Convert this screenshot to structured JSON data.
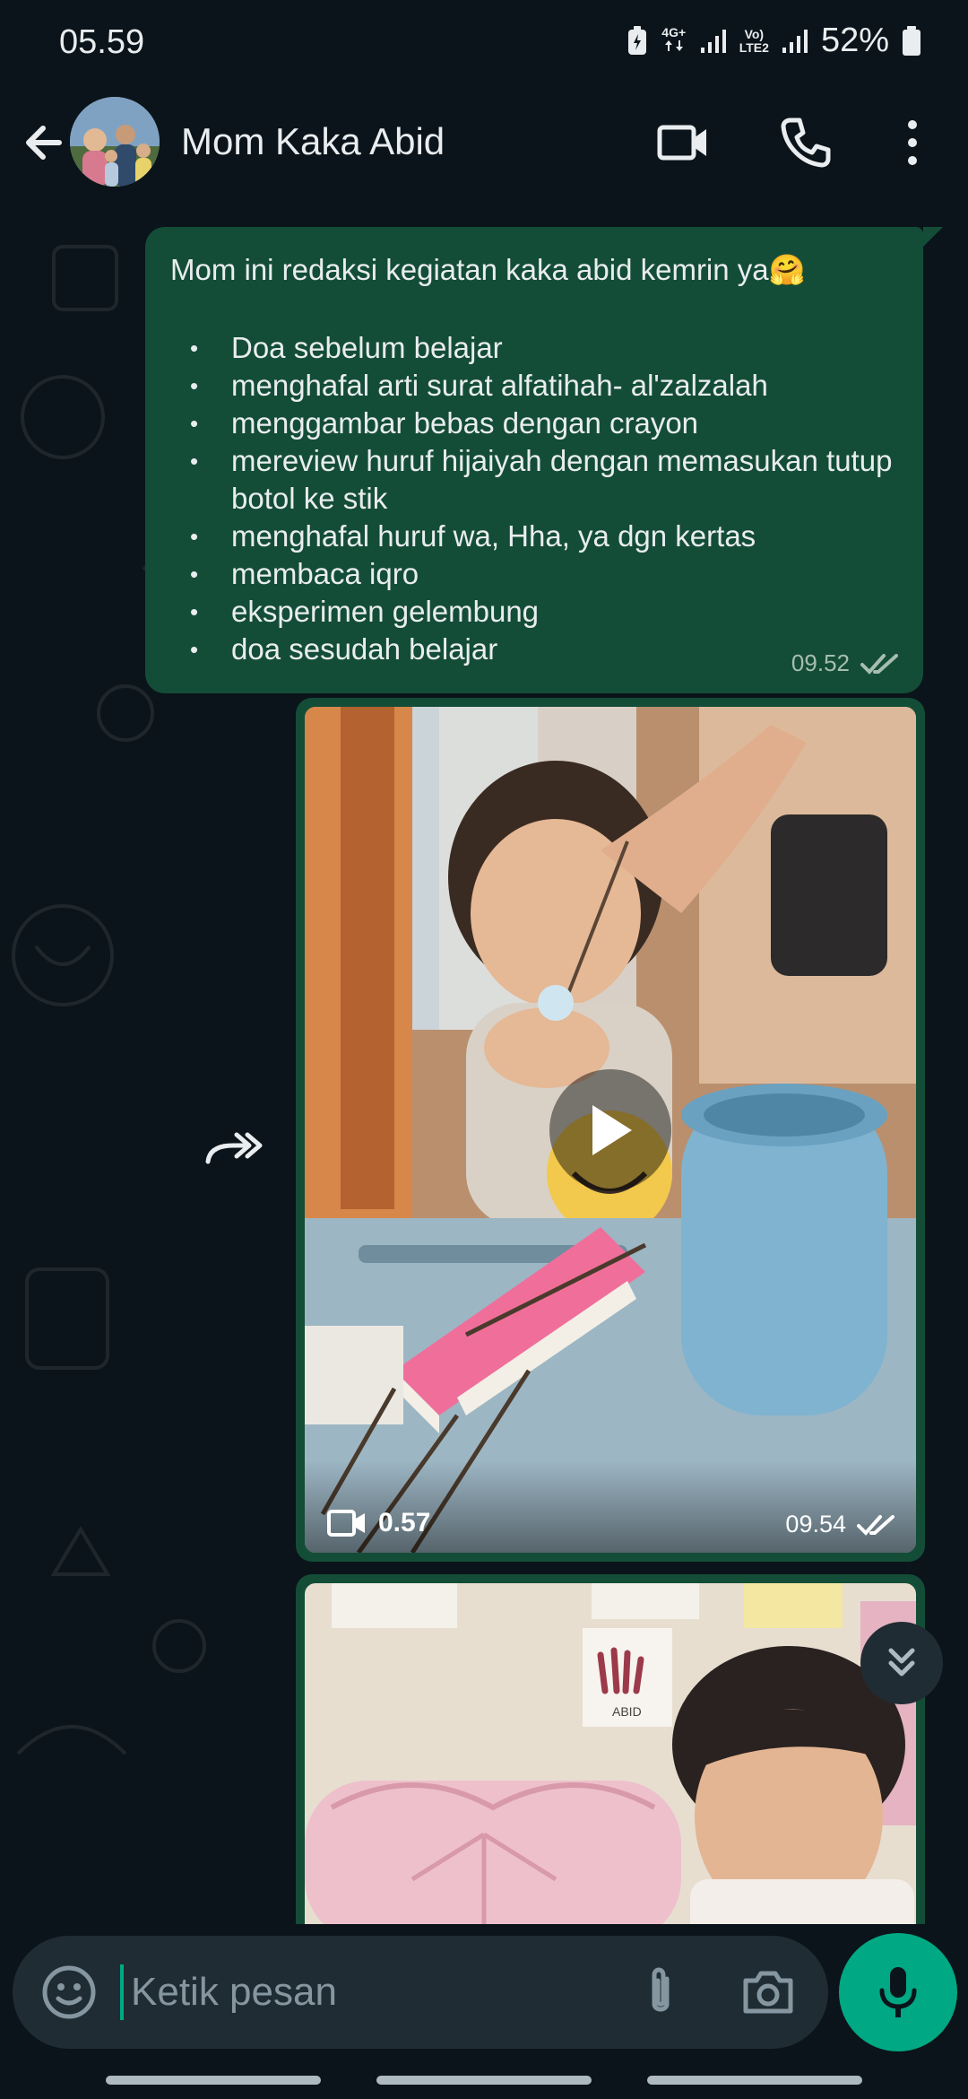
{
  "status_bar": {
    "time": "05.59",
    "net_top": "4G+",
    "volte_top": "Vo)",
    "volte_bottom": "LTE2",
    "battery_pct": "52%"
  },
  "header": {
    "contact_name": "Mom Kaka Abid",
    "icons": [
      "arrow-left-icon",
      "video-call-icon",
      "phone-icon",
      "more-vert-icon"
    ]
  },
  "messages": {
    "text_message": {
      "intro": "Mom ini redaksi kegiatan kaka abid kemrin ya🤗",
      "items": [
        "Doa sebelum belajar",
        "menghafal arti surat alfatihah- al'zalzalah",
        "menggambar bebas dengan crayon",
        "mereview huruf hijaiyah dengan memasukan tutup botol ke stik",
        "menghafal huruf wa, Hha, ya dgn kertas",
        "membaca iqro",
        "eksperimen gelembung",
        "doa sesudah belajar"
      ],
      "time": "09.52"
    },
    "video_message": {
      "duration": "0.57",
      "time": "09.54"
    },
    "image_message": {
      "wall_text": "ABID"
    }
  },
  "input": {
    "placeholder": "Ketik pesan"
  },
  "colors": {
    "background": "#0b141a",
    "bubble_out": "#144d37",
    "accent": "#00a884",
    "input_bar": "#202c33"
  }
}
